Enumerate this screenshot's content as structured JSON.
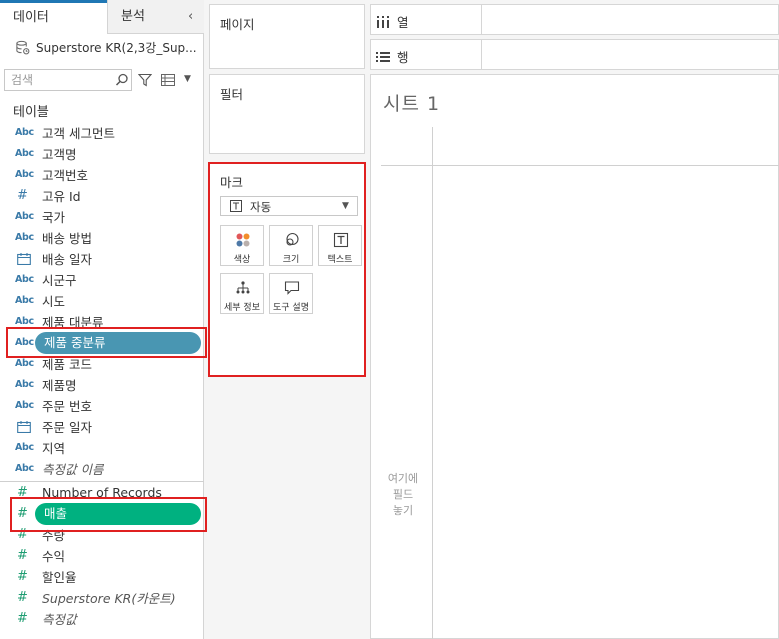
{
  "left_pane": {
    "tabs": [
      "데이터",
      "분석"
    ],
    "collapse_glyph": "‹",
    "datasource_name": "Superstore KR(2,3강_Sup...",
    "search_placeholder": "검색",
    "tables_header": "테이블",
    "dimensions": [
      {
        "type": "Abc",
        "name": "고객 세그먼트"
      },
      {
        "type": "Abc",
        "name": "고객명"
      },
      {
        "type": "Abc",
        "name": "고객번호"
      },
      {
        "type": "#",
        "name": "고유 Id"
      },
      {
        "type": "Abc",
        "name": "국가"
      },
      {
        "type": "Abc",
        "name": "배송 방법"
      },
      {
        "type": "date",
        "name": "배송 일자"
      },
      {
        "type": "Abc",
        "name": "시군구"
      },
      {
        "type": "Abc",
        "name": "시도"
      },
      {
        "type": "Abc",
        "name": "제품 대분류"
      },
      {
        "type": "Abc",
        "name": "제품 중분류",
        "selected": true
      },
      {
        "type": "Abc",
        "name": "제품 코드"
      },
      {
        "type": "Abc",
        "name": "제품명"
      },
      {
        "type": "Abc",
        "name": "주문 번호"
      },
      {
        "type": "date",
        "name": "주문 일자"
      },
      {
        "type": "Abc",
        "name": "지역"
      },
      {
        "type": "Abc",
        "name": "측정값 이름",
        "italic": true
      }
    ],
    "measures": [
      {
        "type": "#",
        "name": "Number of Records"
      },
      {
        "type": "#",
        "name": "매출",
        "selected": true
      },
      {
        "type": "#",
        "name": "수량"
      },
      {
        "type": "#",
        "name": "수익"
      },
      {
        "type": "#",
        "name": "할인율"
      },
      {
        "type": "#",
        "name": "Superstore KR(카운트)",
        "italic": true
      },
      {
        "type": "#",
        "name": "측정값",
        "italic": true
      }
    ]
  },
  "shelves": {
    "pages_label": "페이지",
    "filters_label": "필터",
    "columns_label": "열",
    "rows_label": "행"
  },
  "marks": {
    "title": "마크",
    "type_label": "자동",
    "buttons": [
      "색상",
      "크기",
      "텍스트",
      "세부 정보",
      "도구 설명"
    ]
  },
  "sheet": {
    "title": "시트 1",
    "drop_hint": [
      "여기에",
      "필드",
      "놓기"
    ]
  },
  "colors": {
    "dimension_pill": "#4996b2",
    "measure_pill": "#00b180",
    "highlight": "#e02020",
    "dimension_icon": "#3a7aa8",
    "measure_icon": "#1e9d72"
  }
}
